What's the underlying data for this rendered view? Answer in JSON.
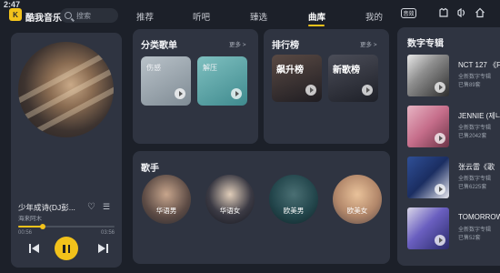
{
  "status": {
    "time": "2:47"
  },
  "app": {
    "logo_text": "K",
    "name": "酷我音乐"
  },
  "search": {
    "placeholder": "搜索"
  },
  "tabs": [
    {
      "label": "推荐"
    },
    {
      "label": "听吧"
    },
    {
      "label": "臻选"
    },
    {
      "label": "曲库"
    },
    {
      "label": "我的"
    }
  ],
  "header_right": {
    "vip_label": "音效"
  },
  "player": {
    "song_title": "少年成诗(DJ彭...",
    "artist": "海来阿木",
    "current_time": "00:56",
    "total_time": "03:56",
    "progress": 0.25
  },
  "categories": {
    "title": "分类歌单",
    "more": "更多 >",
    "items": [
      {
        "label": "伤感"
      },
      {
        "label": "解压"
      }
    ]
  },
  "rankings": {
    "title": "排行榜",
    "more": "更多 >",
    "items": [
      {
        "label": "飙升榜"
      },
      {
        "label": "新歌榜"
      }
    ]
  },
  "singers": {
    "title": "歌手",
    "items": [
      {
        "label": "华语男"
      },
      {
        "label": "华语女"
      },
      {
        "label": "欧美男"
      },
      {
        "label": "欧美女"
      }
    ]
  },
  "digital_albums": {
    "title": "数字专辑",
    "items": [
      {
        "title": "NCT 127 《Fa",
        "subtitle": "全新数字专辑",
        "count": "已售89套"
      },
      {
        "title": "JENNIE (제니",
        "subtitle": "全新数字专辑",
        "count": "已售2042套"
      },
      {
        "title": "张云雷《歌",
        "subtitle": "全新数字专辑",
        "count": "已售6225套"
      },
      {
        "title": "TOMORROW",
        "subtitle": "全新数字专辑",
        "count": "已售52套"
      }
    ]
  },
  "colors": {
    "accent": "#f2c21b",
    "background": "#1c2029",
    "card": "#2f3441"
  }
}
